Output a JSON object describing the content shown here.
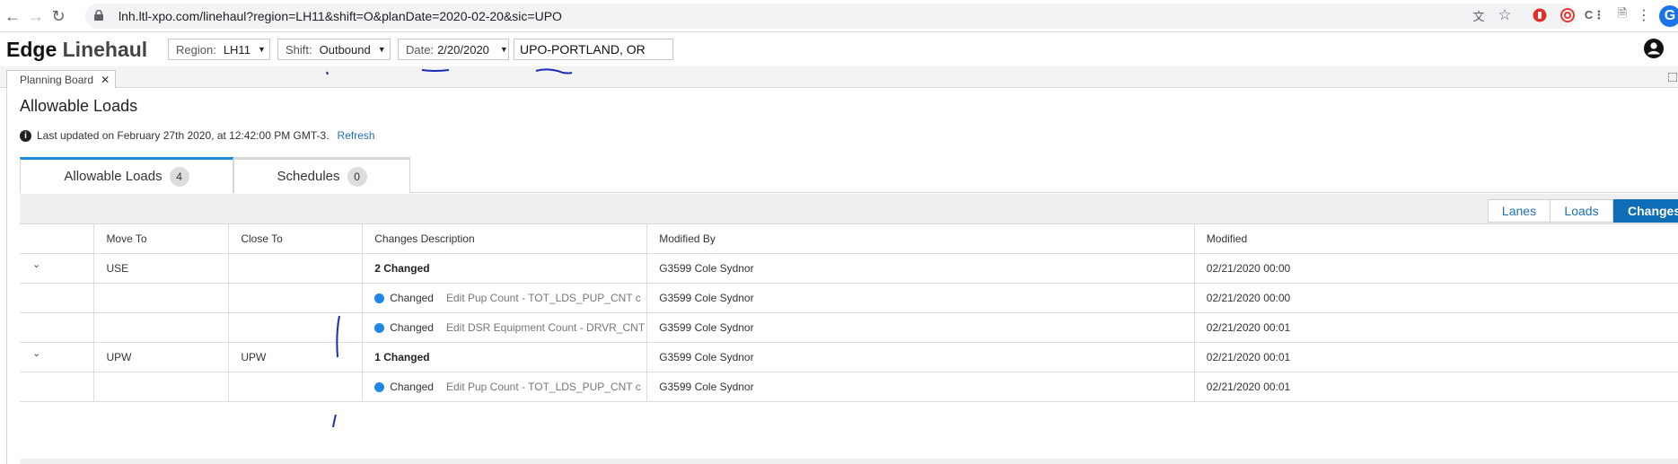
{
  "browser": {
    "url": "lnh.ltl-xpo.com/linehaul?region=LH11&shift=O&planDate=2020-02-20&sic=UPO",
    "profile_letter": "G"
  },
  "app": {
    "brand_bold": "Edge",
    "brand_light": " Linehaul",
    "region": {
      "label": "Region:",
      "value": "LH11"
    },
    "shift": {
      "label": "Shift:",
      "value": "Outbound"
    },
    "date": {
      "label": "Date:",
      "value": "2/20/2020"
    },
    "site": "UPO-PORTLAND, OR"
  },
  "tabstrip": {
    "planning_board": "Planning Board"
  },
  "page": {
    "title": "Allowable Loads",
    "last_updated": "Last updated on February 27th 2020, at 12:42:00 PM GMT-3.",
    "refresh": "Refresh"
  },
  "tabs": [
    {
      "label": "Allowable Loads",
      "count": "4"
    },
    {
      "label": "Schedules",
      "count": "0"
    }
  ],
  "toolbar": {
    "lanes": "Lanes",
    "loads": "Loads",
    "changes": "Changes"
  },
  "table": {
    "headers": [
      "",
      "Move To",
      "Close To",
      "Changes Description",
      "Modified By",
      "Modified"
    ],
    "rows": [
      {
        "expand": "⌄",
        "move_to": "USE",
        "close_to": "",
        "status": "",
        "desc": "2 Changed",
        "modified_by": "G3599 Cole Sydnor",
        "modified": "02/21/2020 00:00"
      },
      {
        "expand": "",
        "move_to": "",
        "close_to": "",
        "status": "Changed",
        "desc": "Edit Pup Count - TOT_LDS_PUP_CNT c",
        "modified_by": "G3599 Cole Sydnor",
        "modified": "02/21/2020 00:00"
      },
      {
        "expand": "",
        "move_to": "",
        "close_to": "",
        "status": "Changed",
        "desc": "Edit DSR Equipment Count - DRVR_CNT",
        "modified_by": "G3599 Cole Sydnor",
        "modified": "02/21/2020 00:01"
      },
      {
        "expand": "⌄",
        "move_to": "UPW",
        "close_to": "UPW",
        "status": "",
        "desc": "1 Changed",
        "modified_by": "G3599 Cole Sydnor",
        "modified": "02/21/2020 00:01"
      },
      {
        "expand": "",
        "move_to": "",
        "close_to": "",
        "status": "Changed",
        "desc": "Edit Pup Count - TOT_LDS_PUP_CNT c",
        "modified_by": "G3599 Cole Sydnor",
        "modified": "02/21/2020 00:01"
      }
    ]
  },
  "colors": {
    "accent": "#0f6cb7",
    "status_dot": "#1e88e5",
    "active_tab": "#1f88d8"
  }
}
